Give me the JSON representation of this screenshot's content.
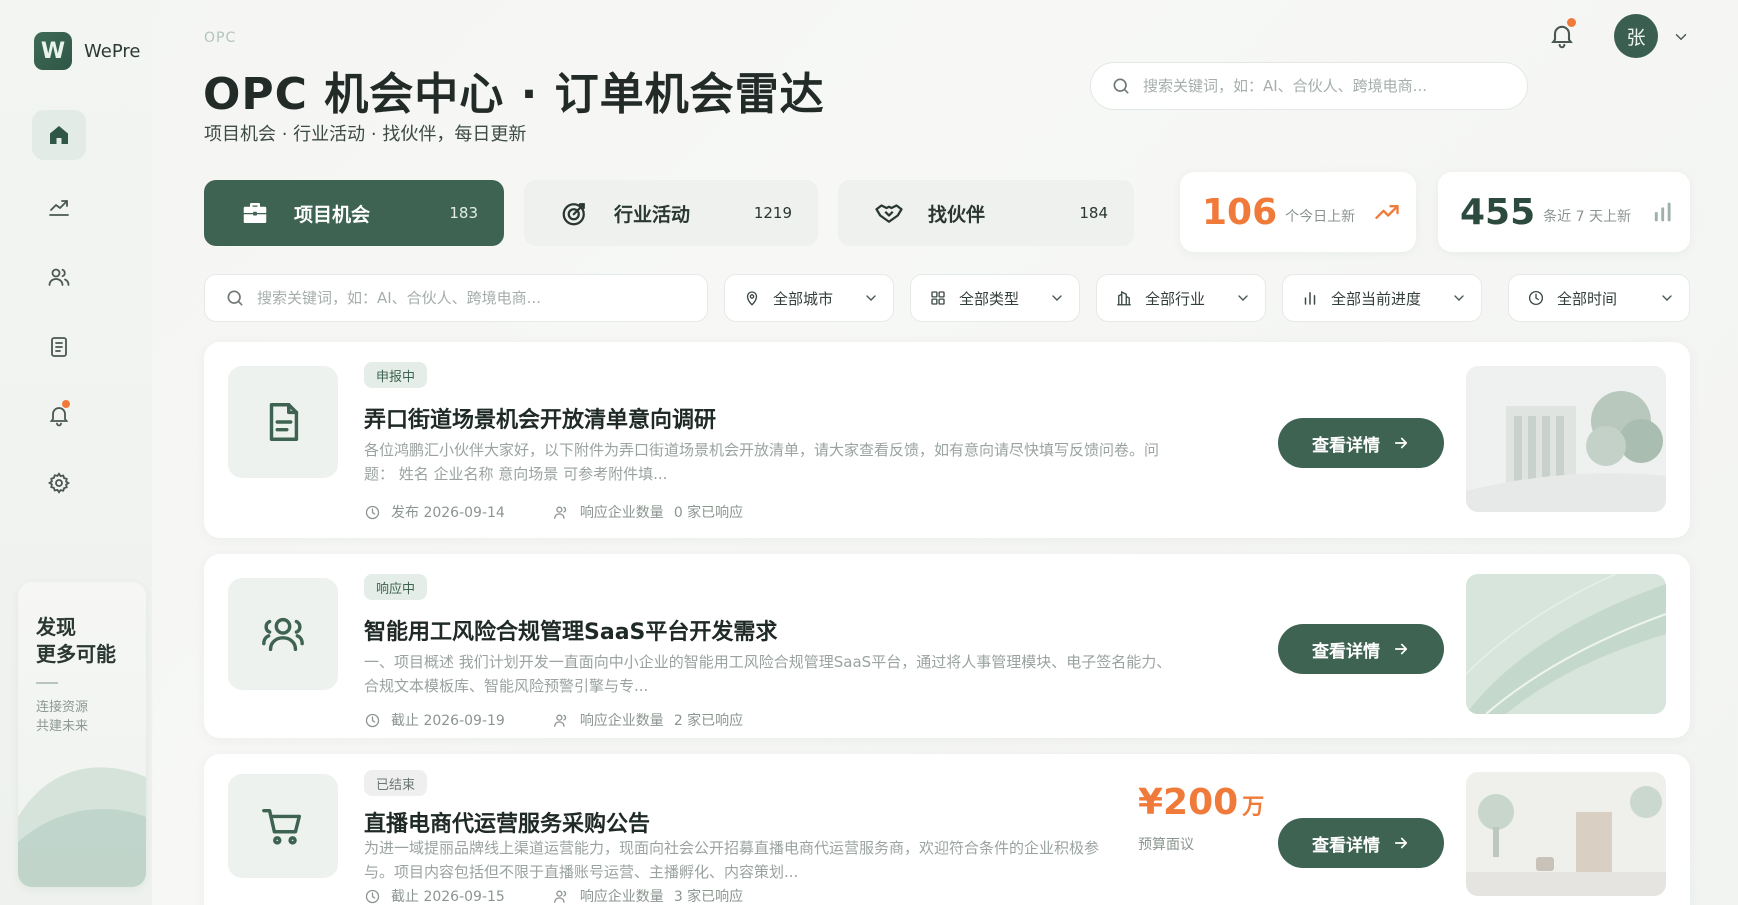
{
  "app": {
    "logo_letter": "W",
    "logo_text": "WePre"
  },
  "sidebar": {
    "items": [
      {
        "icon": "home-icon"
      },
      {
        "icon": "trend-icon"
      },
      {
        "icon": "users-icon"
      },
      {
        "icon": "document-icon"
      },
      {
        "icon": "bell-icon",
        "dot": true
      },
      {
        "icon": "gear-icon"
      }
    ],
    "promo": {
      "title_line1": "发现",
      "title_line2": "更多可能",
      "sub_line1": "连接资源",
      "sub_line2": "共建未来"
    }
  },
  "header": {
    "eyebrow": "OPC",
    "title": "OPC 机会中心 · 订单机会雷达",
    "subtitle": "项目机会 · 行业活动 · 找伙伴，每日更新",
    "search_placeholder": "搜索关键词，如：AI、合伙人、跨境电商...",
    "avatar_text": "张"
  },
  "tabs": [
    {
      "label": "项目机会",
      "count": "183",
      "icon": "briefcase-icon",
      "active": true
    },
    {
      "label": "行业活动",
      "count": "1219",
      "icon": "target-icon",
      "active": false
    },
    {
      "label": "找伙伴",
      "count": "184",
      "icon": "handshake-icon",
      "active": false
    }
  ],
  "stats": [
    {
      "value": "106",
      "label": "个今日上新",
      "color": "#f07a3a"
    },
    {
      "value": "455",
      "label": "条近 7 天上新",
      "color": "#2d4a3e"
    }
  ],
  "filters": {
    "search_placeholder": "搜索关键词，如：AI、合伙人、跨境电商...",
    "items": [
      {
        "label": "全部城市",
        "icon": "location-icon"
      },
      {
        "label": "全部类型",
        "icon": "grid-icon"
      },
      {
        "label": "全部行业",
        "icon": "building-icon"
      },
      {
        "label": "全部当前进度",
        "icon": "bars-icon"
      },
      {
        "label": "全部时间",
        "icon": "clock-icon"
      }
    ]
  },
  "cards": [
    {
      "badge": "申报中",
      "title": "弄口街道场景机会开放清单意向调研",
      "desc": "各位鸿鹏汇小伙伴大家好，以下附件为弄口街道场景机会开放清单，请大家查看反馈，如有意向请尽快填写反馈问卷。问题： 姓名 企业名称 意向场景 可参考附件填...",
      "date_label": "发布 2026-09-14",
      "response_label": "响应企业数量",
      "response_value": "0 家已响应",
      "button": "查看详情"
    },
    {
      "badge": "响应中",
      "title": "智能用工风险合规管理SaaS平台开发需求",
      "desc": "一、项目概述 我们计划开发一直面向中小企业的智能用工风险合规管理SaaS平台，通过将人事管理模块、电子签名能力、合规文本模板库、智能风险预警引擎与专...",
      "date_label": "截止 2026-09-19",
      "response_label": "响应企业数量",
      "response_value": "2 家已响应",
      "button": "查看详情"
    },
    {
      "badge": "已结束",
      "title": "直播电商代运营服务采购公告",
      "desc": "为进一域提丽品牌线上渠道运营能力，现面向社会公开招募直播电商代运营服务商，欢迎符合条件的企业积极参与。项目内容包括但不限于直播账号运营、主播孵化、内容策划...",
      "date_label": "截止 2026-09-15",
      "response_label": "响应企业数量",
      "response_value": "3 家已响应",
      "button": "查看详情",
      "budget_amount": "¥200",
      "budget_unit": "万",
      "budget_label": "预算面议"
    }
  ]
}
